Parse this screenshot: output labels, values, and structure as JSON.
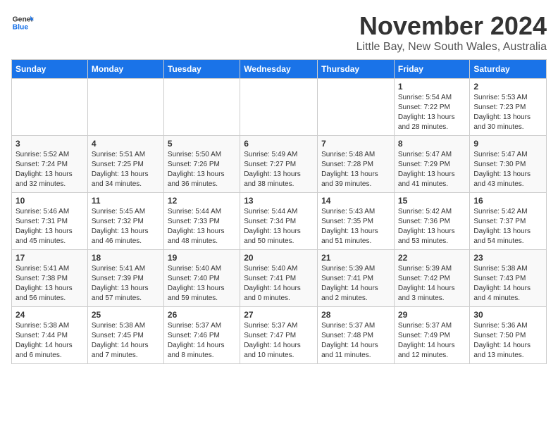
{
  "header": {
    "logo_line1": "General",
    "logo_line2": "Blue",
    "month": "November 2024",
    "location": "Little Bay, New South Wales, Australia"
  },
  "weekdays": [
    "Sunday",
    "Monday",
    "Tuesday",
    "Wednesday",
    "Thursday",
    "Friday",
    "Saturday"
  ],
  "weeks": [
    [
      {
        "day": "",
        "info": ""
      },
      {
        "day": "",
        "info": ""
      },
      {
        "day": "",
        "info": ""
      },
      {
        "day": "",
        "info": ""
      },
      {
        "day": "",
        "info": ""
      },
      {
        "day": "1",
        "info": "Sunrise: 5:54 AM\nSunset: 7:22 PM\nDaylight: 13 hours\nand 28 minutes."
      },
      {
        "day": "2",
        "info": "Sunrise: 5:53 AM\nSunset: 7:23 PM\nDaylight: 13 hours\nand 30 minutes."
      }
    ],
    [
      {
        "day": "3",
        "info": "Sunrise: 5:52 AM\nSunset: 7:24 PM\nDaylight: 13 hours\nand 32 minutes."
      },
      {
        "day": "4",
        "info": "Sunrise: 5:51 AM\nSunset: 7:25 PM\nDaylight: 13 hours\nand 34 minutes."
      },
      {
        "day": "5",
        "info": "Sunrise: 5:50 AM\nSunset: 7:26 PM\nDaylight: 13 hours\nand 36 minutes."
      },
      {
        "day": "6",
        "info": "Sunrise: 5:49 AM\nSunset: 7:27 PM\nDaylight: 13 hours\nand 38 minutes."
      },
      {
        "day": "7",
        "info": "Sunrise: 5:48 AM\nSunset: 7:28 PM\nDaylight: 13 hours\nand 39 minutes."
      },
      {
        "day": "8",
        "info": "Sunrise: 5:47 AM\nSunset: 7:29 PM\nDaylight: 13 hours\nand 41 minutes."
      },
      {
        "day": "9",
        "info": "Sunrise: 5:47 AM\nSunset: 7:30 PM\nDaylight: 13 hours\nand 43 minutes."
      }
    ],
    [
      {
        "day": "10",
        "info": "Sunrise: 5:46 AM\nSunset: 7:31 PM\nDaylight: 13 hours\nand 45 minutes."
      },
      {
        "day": "11",
        "info": "Sunrise: 5:45 AM\nSunset: 7:32 PM\nDaylight: 13 hours\nand 46 minutes."
      },
      {
        "day": "12",
        "info": "Sunrise: 5:44 AM\nSunset: 7:33 PM\nDaylight: 13 hours\nand 48 minutes."
      },
      {
        "day": "13",
        "info": "Sunrise: 5:44 AM\nSunset: 7:34 PM\nDaylight: 13 hours\nand 50 minutes."
      },
      {
        "day": "14",
        "info": "Sunrise: 5:43 AM\nSunset: 7:35 PM\nDaylight: 13 hours\nand 51 minutes."
      },
      {
        "day": "15",
        "info": "Sunrise: 5:42 AM\nSunset: 7:36 PM\nDaylight: 13 hours\nand 53 minutes."
      },
      {
        "day": "16",
        "info": "Sunrise: 5:42 AM\nSunset: 7:37 PM\nDaylight: 13 hours\nand 54 minutes."
      }
    ],
    [
      {
        "day": "17",
        "info": "Sunrise: 5:41 AM\nSunset: 7:38 PM\nDaylight: 13 hours\nand 56 minutes."
      },
      {
        "day": "18",
        "info": "Sunrise: 5:41 AM\nSunset: 7:39 PM\nDaylight: 13 hours\nand 57 minutes."
      },
      {
        "day": "19",
        "info": "Sunrise: 5:40 AM\nSunset: 7:40 PM\nDaylight: 13 hours\nand 59 minutes."
      },
      {
        "day": "20",
        "info": "Sunrise: 5:40 AM\nSunset: 7:41 PM\nDaylight: 14 hours\nand 0 minutes."
      },
      {
        "day": "21",
        "info": "Sunrise: 5:39 AM\nSunset: 7:41 PM\nDaylight: 14 hours\nand 2 minutes."
      },
      {
        "day": "22",
        "info": "Sunrise: 5:39 AM\nSunset: 7:42 PM\nDaylight: 14 hours\nand 3 minutes."
      },
      {
        "day": "23",
        "info": "Sunrise: 5:38 AM\nSunset: 7:43 PM\nDaylight: 14 hours\nand 4 minutes."
      }
    ],
    [
      {
        "day": "24",
        "info": "Sunrise: 5:38 AM\nSunset: 7:44 PM\nDaylight: 14 hours\nand 6 minutes."
      },
      {
        "day": "25",
        "info": "Sunrise: 5:38 AM\nSunset: 7:45 PM\nDaylight: 14 hours\nand 7 minutes."
      },
      {
        "day": "26",
        "info": "Sunrise: 5:37 AM\nSunset: 7:46 PM\nDaylight: 14 hours\nand 8 minutes."
      },
      {
        "day": "27",
        "info": "Sunrise: 5:37 AM\nSunset: 7:47 PM\nDaylight: 14 hours\nand 10 minutes."
      },
      {
        "day": "28",
        "info": "Sunrise: 5:37 AM\nSunset: 7:48 PM\nDaylight: 14 hours\nand 11 minutes."
      },
      {
        "day": "29",
        "info": "Sunrise: 5:37 AM\nSunset: 7:49 PM\nDaylight: 14 hours\nand 12 minutes."
      },
      {
        "day": "30",
        "info": "Sunrise: 5:36 AM\nSunset: 7:50 PM\nDaylight: 14 hours\nand 13 minutes."
      }
    ]
  ]
}
